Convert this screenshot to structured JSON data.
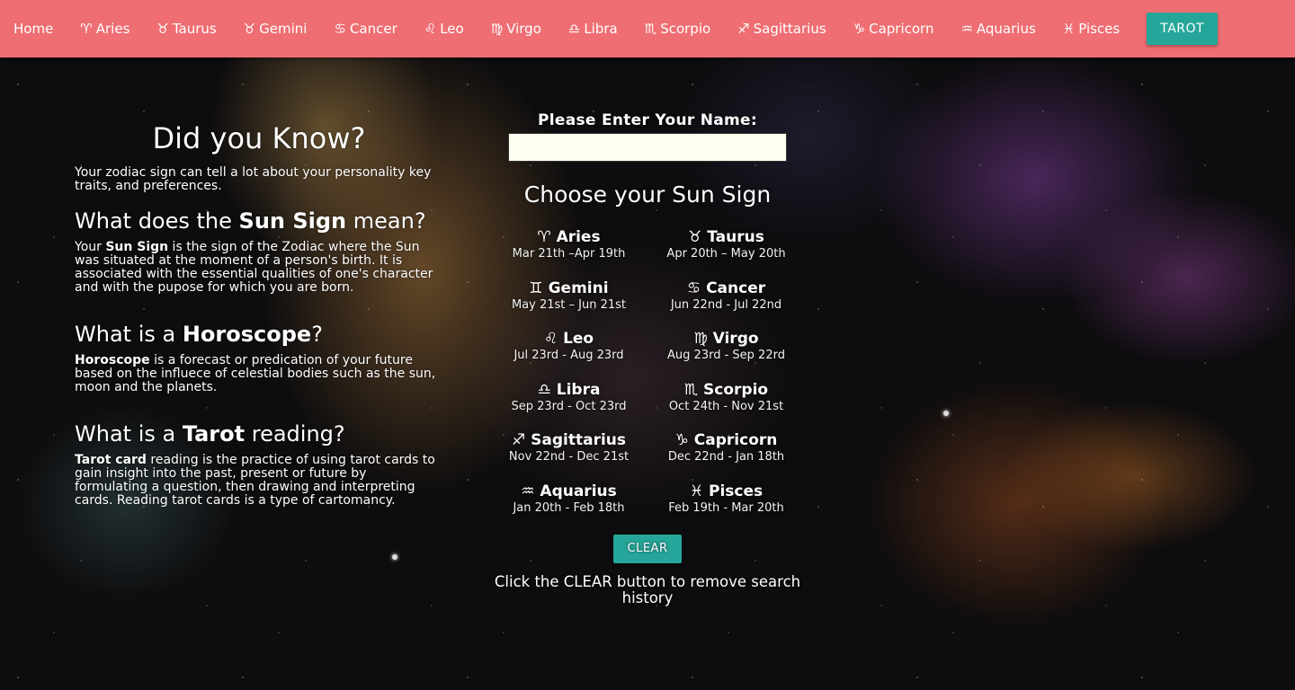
{
  "nav": {
    "home": "Home",
    "links": [
      {
        "glyph": "♈",
        "label": "Aries"
      },
      {
        "glyph": "♉",
        "label": "Taurus"
      },
      {
        "glyph": "♉",
        "label": "Gemini"
      },
      {
        "glyph": "♋",
        "label": "Cancer"
      },
      {
        "glyph": "♌",
        "label": "Leo"
      },
      {
        "glyph": "♍",
        "label": "Virgo"
      },
      {
        "glyph": "♎",
        "label": "Libra"
      },
      {
        "glyph": "♏",
        "label": "Scorpio"
      },
      {
        "glyph": "♐",
        "label": "Sagittarius"
      },
      {
        "glyph": "♑",
        "label": "Capricorn"
      },
      {
        "glyph": "♒",
        "label": "Aquarius"
      },
      {
        "glyph": "♓",
        "label": "Pisces"
      }
    ],
    "tarot_label": "TAROT"
  },
  "info": {
    "title": "Did you Know?",
    "intro": "Your zodiac sign can tell a lot about your personality key traits, and preferences.",
    "sun_heading": {
      "pre": "What does the ",
      "bold": "Sun Sign",
      "post": " mean?"
    },
    "sun_text": {
      "pre": "Your ",
      "bold": "Sun Sign",
      "post": " is the sign of the Zodiac where the Sun was situated at the moment of a person's birth. It is associated with the essential qualities of one's character and with the pupose for which you are born."
    },
    "horoscope_heading": {
      "pre": "What is a ",
      "bold": "Horoscope",
      "post": "?"
    },
    "horoscope_text": {
      "bold": "Horoscope",
      "post": " is a forecast or predication of your future based on the influece of celestial bodies such as the sun, moon and the planets."
    },
    "tarot_heading": {
      "pre": "What is a ",
      "bold": "Tarot",
      "post": " reading?"
    },
    "tarot_text": {
      "bold": "Tarot card",
      "post": " reading is the practice of using tarot cards to gain insight into the past, present or future by formulating a question, then drawing and interpreting cards. Reading tarot cards is a type of cartomancy."
    }
  },
  "form": {
    "name_label": "Please Enter Your Name:",
    "name_value": "",
    "choose_label": "Choose your Sun Sign",
    "signs": [
      {
        "glyph": "♈",
        "name": "Aries",
        "dates": "Mar 21th –Apr 19th"
      },
      {
        "glyph": "♉",
        "name": "Taurus",
        "dates": "Apr 20th – May 20th"
      },
      {
        "glyph": "♊",
        "name": "Gemini",
        "dates": "May 21st – Jun 21st"
      },
      {
        "glyph": "♋",
        "name": "Cancer",
        "dates": "Jun 22nd - Jul 22nd"
      },
      {
        "glyph": "♌",
        "name": "Leo",
        "dates": "Jul 23rd - Aug 23rd"
      },
      {
        "glyph": "♍",
        "name": "Virgo",
        "dates": "Aug 23rd - Sep 22rd"
      },
      {
        "glyph": "♎",
        "name": "Libra",
        "dates": "Sep 23rd - Oct 23rd"
      },
      {
        "glyph": "♏",
        "name": "Scorpio",
        "dates": "Oct 24th - Nov 21st"
      },
      {
        "glyph": "♐",
        "name": "Sagittarius",
        "dates": "Nov 22nd - Dec 21st"
      },
      {
        "glyph": "♑",
        "name": "Capricorn",
        "dates": "Dec 22nd - Jan 18th"
      },
      {
        "glyph": "♒",
        "name": "Aquarius",
        "dates": "Jan 20th - Feb 18th"
      },
      {
        "glyph": "♓",
        "name": "Pisces",
        "dates": "Feb 19th - Mar 20th"
      }
    ],
    "clear_label": "CLEAR",
    "hint": "Click the CLEAR button to remove search history"
  },
  "colors": {
    "navbar": "#ee6e73",
    "button": "#26a69a",
    "input_bg": "#fffff0"
  }
}
